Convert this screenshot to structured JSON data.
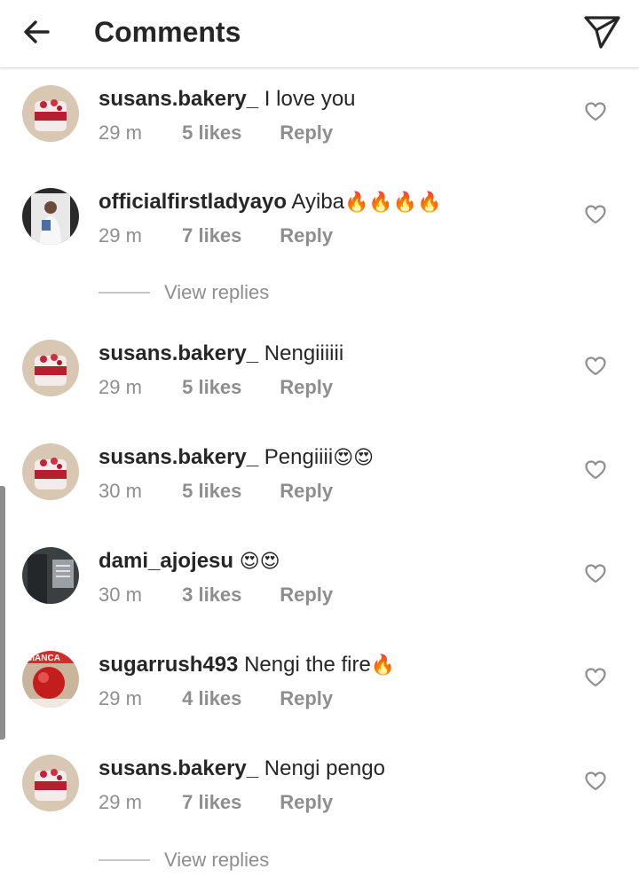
{
  "header": {
    "title": "Comments",
    "back_icon": "arrow-left-icon",
    "send_icon": "paper-plane-icon"
  },
  "comments": [
    {
      "username": "susans.bakery_",
      "text": "I love you",
      "emoji": "",
      "time": "29 m",
      "likes": "5 likes",
      "reply": "Reply",
      "avatar": "cake-avatar"
    },
    {
      "username": "officialfirstladyayo",
      "text": "Ayiba",
      "emoji": "🔥🔥🔥🔥",
      "time": "29 m",
      "likes": "7 likes",
      "reply": "Reply",
      "avatar": "person-photo-avatar"
    },
    {
      "username": "susans.bakery_",
      "text": "Nengiiiiii",
      "emoji": "",
      "time": "29 m",
      "likes": "5 likes",
      "reply": "Reply",
      "avatar": "cake-avatar"
    },
    {
      "username": "susans.bakery_",
      "text": "Pengiiii",
      "emoji": "😍😍",
      "time": "30 m",
      "likes": "5 likes",
      "reply": "Reply",
      "avatar": "cake-avatar"
    },
    {
      "username": "dami_ajojesu",
      "text": "",
      "emoji": "😍😍",
      "time": "30 m",
      "likes": "3 likes",
      "reply": "Reply",
      "avatar": "dark-photo-avatar"
    },
    {
      "username": "sugarrush493",
      "text": "Nengi the fire",
      "emoji": "🔥",
      "time": "29 m",
      "likes": "4 likes",
      "reply": "Reply",
      "avatar": "product-avatar"
    },
    {
      "username": "susans.bakery_",
      "text": "Nengi pengo",
      "emoji": "",
      "time": "29 m",
      "likes": "7 likes",
      "reply": "Reply",
      "avatar": "cake-avatar"
    }
  ],
  "view_replies": [
    "View replies",
    "View replies"
  ],
  "avatar_labels": {
    "product_brand": "BIANCA"
  },
  "colors": {
    "text": "#262626",
    "muted": "#8e8e8e",
    "divider": "#c7c7c7",
    "accent_red": "#d62b2b"
  }
}
